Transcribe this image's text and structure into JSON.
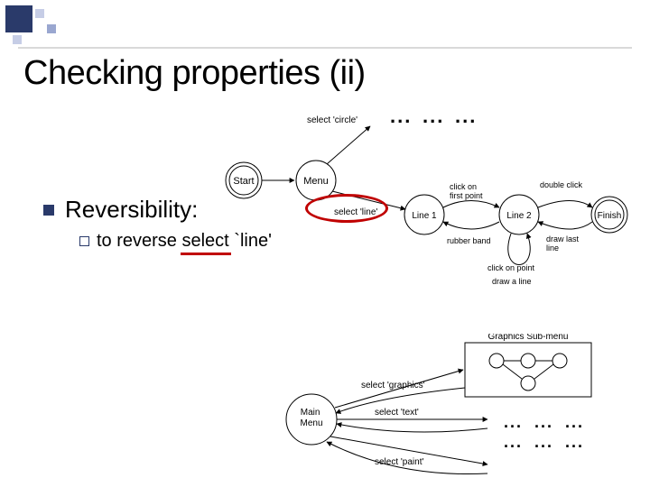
{
  "title": "Checking properties (ii)",
  "bullet": {
    "text": "Reversibility:",
    "sub": "to reverse select `line'"
  },
  "diagram_top": {
    "nodes": {
      "start": "Start",
      "menu": "Menu",
      "line1": "Line 1",
      "line2": "Line 2",
      "finish": "Finish"
    },
    "edges": {
      "select_circle": "select 'circle'",
      "select_line": "select 'line'",
      "click_first": "click on\nfirst point",
      "rubber_band": "rubber band",
      "double_click": "double click",
      "draw_last": "draw last\nline",
      "click_point": "click on point",
      "draw_line": "draw a line"
    },
    "ellipsis": "..."
  },
  "diagram_bottom": {
    "nodes": {
      "main_menu": "Main\nMenu",
      "submenu_title": "Graphics Sub-menu"
    },
    "edges": {
      "select_graphics": "select 'graphics'",
      "select_text": "select 'text'",
      "select_paint": "select 'paint'"
    },
    "ellipsis": "..."
  }
}
